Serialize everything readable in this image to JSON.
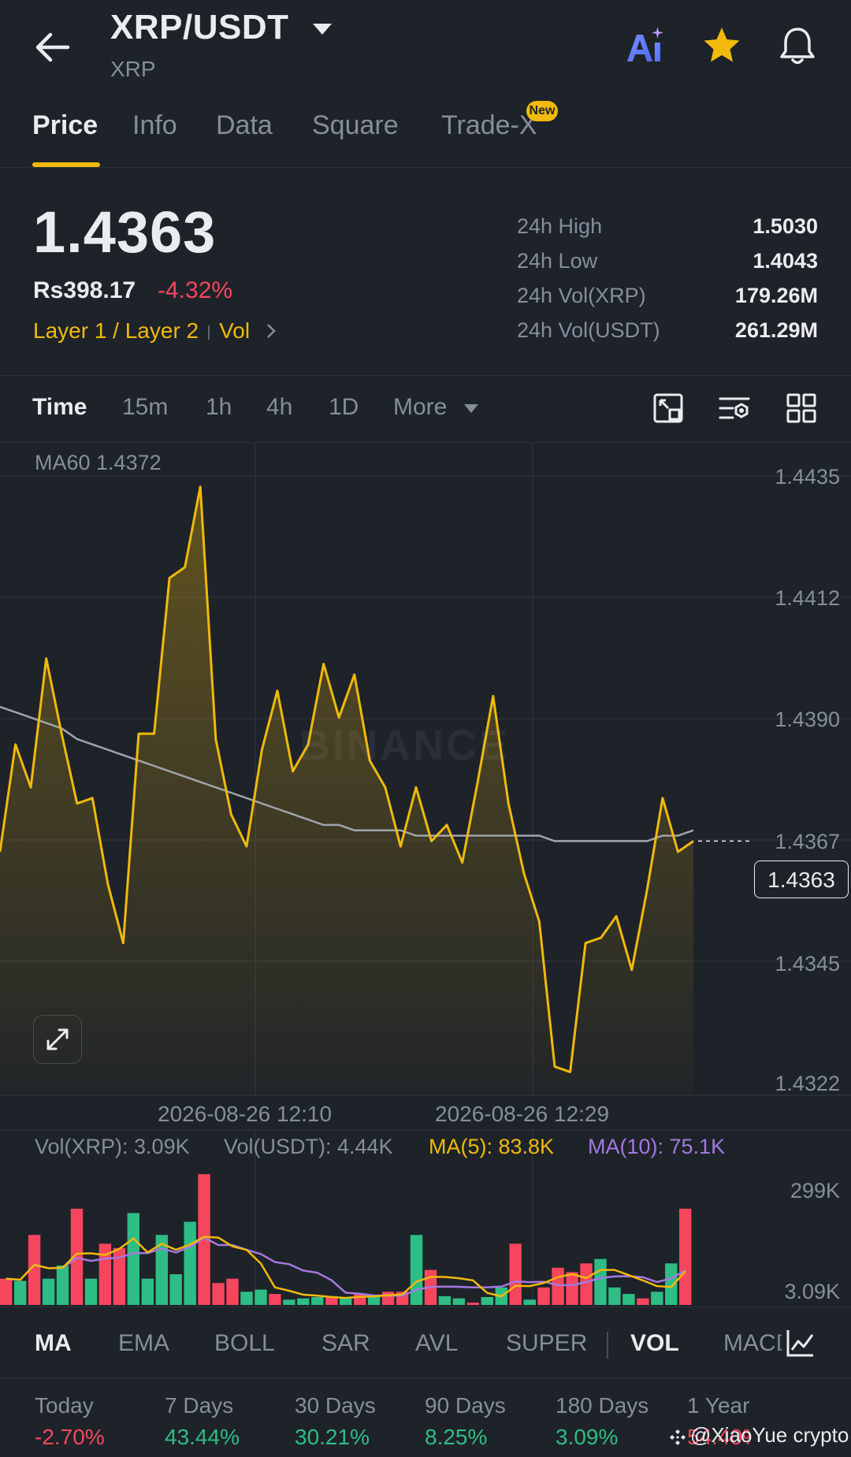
{
  "header": {
    "pair": "XRP/USDT",
    "base": "XRP"
  },
  "tabs": [
    {
      "label": "Price"
    },
    {
      "label": "Info"
    },
    {
      "label": "Data"
    },
    {
      "label": "Square"
    },
    {
      "label": "Trade-X",
      "badge": "New"
    }
  ],
  "price": {
    "last": "1.4363",
    "fiat": "Rs398.17",
    "change": "-4.32%",
    "tag1": "Layer 1 / Layer 2",
    "tag2": "Vol"
  },
  "stats": [
    {
      "label": "24h High",
      "value": "1.5030"
    },
    {
      "label": "24h Low",
      "value": "1.4043"
    },
    {
      "label": "24h Vol(XRP)",
      "value": "179.26M"
    },
    {
      "label": "24h Vol(USDT)",
      "value": "261.29M"
    }
  ],
  "timeframes": [
    "Time",
    "15m",
    "1h",
    "4h",
    "1D",
    "More"
  ],
  "chart": {
    "ma60_label": "MA60 1.4372",
    "y_ticks": [
      "1.4435",
      "1.4412",
      "1.4390",
      "1.4367",
      "1.4345",
      "1.4322"
    ],
    "current_tag": "1.4363",
    "x_ticks": [
      "2026-08-26 12:10",
      "2026-08-26 12:29"
    ],
    "watermark": "BINANCE"
  },
  "chart_data": {
    "type": "line",
    "ylim": [
      1.4322,
      1.4435
    ],
    "price": [
      1.4365,
      1.4385,
      1.4377,
      1.4401,
      1.4387,
      1.4374,
      1.4375,
      1.4359,
      1.4348,
      1.4387,
      1.4387,
      1.4416,
      1.4418,
      1.4433,
      1.4386,
      1.4372,
      1.4366,
      1.4384,
      1.4395,
      1.438,
      1.4385,
      1.44,
      1.439,
      1.4398,
      1.4382,
      1.4377,
      1.4366,
      1.4377,
      1.4367,
      1.437,
      1.4363,
      1.4378,
      1.4394,
      1.4374,
      1.4361,
      1.4352,
      1.4325,
      1.4324,
      1.4348,
      1.4349,
      1.4353,
      1.4343,
      1.4358,
      1.4375,
      1.4365,
      1.4367
    ],
    "ma60": [
      1.4392,
      1.4391,
      1.439,
      1.4389,
      1.4388,
      1.4386,
      1.4385,
      1.4384,
      1.4383,
      1.4382,
      1.4381,
      1.438,
      1.4379,
      1.4378,
      1.4377,
      1.4376,
      1.4375,
      1.4374,
      1.4373,
      1.4372,
      1.4371,
      1.437,
      1.437,
      1.4369,
      1.4369,
      1.4369,
      1.4369,
      1.4368,
      1.4368,
      1.4368,
      1.4368,
      1.4368,
      1.4368,
      1.4368,
      1.4368,
      1.4368,
      1.4367,
      1.4367,
      1.4367,
      1.4367,
      1.4367,
      1.4367,
      1.4367,
      1.4368,
      1.4368,
      1.4369
    ],
    "volume_legend": {
      "vol_base": "Vol(XRP): 3.09K",
      "vol_quote": "Vol(USDT): 4.44K",
      "ma5": "MA(5): 83.8K",
      "ma10": "MA(10): 75.1K"
    },
    "volume_axis": [
      "299K",
      "3.09K"
    ],
    "volume": [
      {
        "v": 60,
        "up": false
      },
      {
        "v": 55,
        "up": true
      },
      {
        "v": 160,
        "up": false
      },
      {
        "v": 60,
        "up": true
      },
      {
        "v": 90,
        "up": true
      },
      {
        "v": 220,
        "up": false
      },
      {
        "v": 60,
        "up": true
      },
      {
        "v": 140,
        "up": false
      },
      {
        "v": 130,
        "up": false
      },
      {
        "v": 210,
        "up": true
      },
      {
        "v": 60,
        "up": true
      },
      {
        "v": 160,
        "up": true
      },
      {
        "v": 70,
        "up": true
      },
      {
        "v": 190,
        "up": true
      },
      {
        "v": 299,
        "up": false
      },
      {
        "v": 50,
        "up": false
      },
      {
        "v": 60,
        "up": false
      },
      {
        "v": 30,
        "up": true
      },
      {
        "v": 35,
        "up": true
      },
      {
        "v": 25,
        "up": false
      },
      {
        "v": 12,
        "up": true
      },
      {
        "v": 15,
        "up": true
      },
      {
        "v": 18,
        "up": true
      },
      {
        "v": 20,
        "up": false
      },
      {
        "v": 15,
        "up": true
      },
      {
        "v": 25,
        "up": false
      },
      {
        "v": 20,
        "up": true
      },
      {
        "v": 30,
        "up": false
      },
      {
        "v": 30,
        "up": false
      },
      {
        "v": 160,
        "up": true
      },
      {
        "v": 80,
        "up": false
      },
      {
        "v": 20,
        "up": true
      },
      {
        "v": 15,
        "up": true
      },
      {
        "v": 5,
        "up": false
      },
      {
        "v": 18,
        "up": true
      },
      {
        "v": 40,
        "up": true
      },
      {
        "v": 140,
        "up": false
      },
      {
        "v": 12,
        "up": true
      },
      {
        "v": 40,
        "up": false
      },
      {
        "v": 85,
        "up": false
      },
      {
        "v": 75,
        "up": false
      },
      {
        "v": 95,
        "up": false
      },
      {
        "v": 105,
        "up": true
      },
      {
        "v": 40,
        "up": true
      },
      {
        "v": 25,
        "up": true
      },
      {
        "v": 15,
        "up": false
      },
      {
        "v": 30,
        "up": true
      },
      {
        "v": 95,
        "up": true
      },
      {
        "v": 220,
        "up": false
      }
    ]
  },
  "indicators": [
    "MA",
    "EMA",
    "BOLL",
    "SAR",
    "AVL",
    "SUPER",
    "VOL",
    "MACD"
  ],
  "performance": [
    {
      "label": "Today",
      "value": "-2.70%",
      "dir": "down"
    },
    {
      "label": "7 Days",
      "value": "43.44%",
      "dir": "up"
    },
    {
      "label": "30 Days",
      "value": "30.21%",
      "dir": "up"
    },
    {
      "label": "90 Days",
      "value": "8.25%",
      "dir": "up"
    },
    {
      "label": "180 Days",
      "value": "3.09%",
      "dir": "up"
    },
    {
      "label": "1 Year",
      "value": "54.40%",
      "dir": "down"
    }
  ],
  "credit": "@XiaoYue crypto"
}
